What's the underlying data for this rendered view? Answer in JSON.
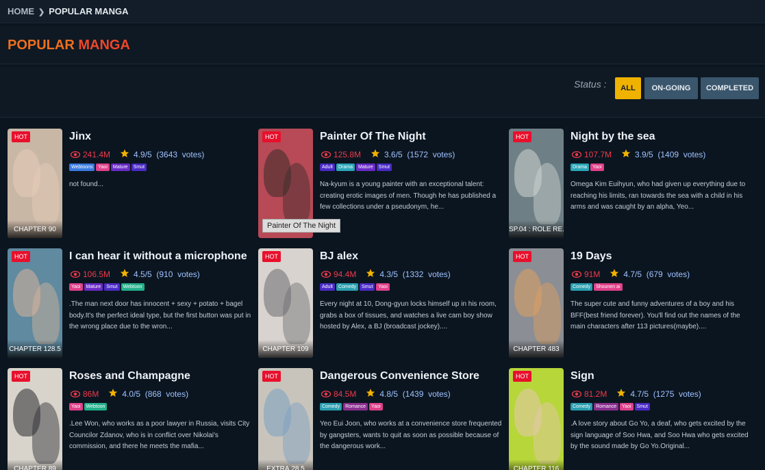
{
  "breadcrumb": {
    "home": "HOME",
    "current": "POPULAR MANGA"
  },
  "page_title": {
    "part1": "POPULAR ",
    "part2": "MANGA"
  },
  "filter": {
    "label": "Status :",
    "all": "ALL",
    "ongoing": "ON-GOING",
    "completed": "COMPLETED",
    "active": "ALL"
  },
  "tooltip": "Painter Of The Night",
  "tag_colors": {
    "Webtoons": "#3a7be0",
    "Yaoi": "#e0408a",
    "Mature": "#6a2bc7",
    "Smut": "#4a2bc7",
    "Adult": "#4a2bc7",
    "Drama": "#2aa7b8",
    "Comedy": "#2a9fb0",
    "Webtoon": "#23b08a",
    "Romance": "#8a2f8f",
    "Shounen ai": "#e0408a"
  },
  "cards": [
    {
      "title": "Jinx",
      "views": "241.4M",
      "rating": "4.9/5  (3643  votes)",
      "tags": [
        "Webtoons",
        "Yaoi",
        "Mature",
        "Smut"
      ],
      "desc": "not found...",
      "hot": "HOT",
      "chapter": "CHAPTER 90",
      "cover_color": "#c9b7a6",
      "fig_color": "#e6cdb8"
    },
    {
      "title": "Painter Of The Night",
      "views": "125.8M",
      "rating": "3.6/5  (1572  votes)",
      "tags": [
        "Adult",
        "Drama",
        "Mature",
        "Smut"
      ],
      "desc": "Na-kyum is a young painter with an exceptional talent: creating erotic images of men. Though he has published a few collections under a pseudonym, he...",
      "hot": "HOT",
      "chapter": "",
      "cover_color": "#b74a56",
      "fig_color": "#3a2c2a"
    },
    {
      "title": "Night by the sea",
      "views": "107.7M",
      "rating": "3.9/5  (1409  votes)",
      "tags": [
        "Drama",
        "Yaoi"
      ],
      "desc": "Omega Kim Euihyun, who had given up everything due to reaching his limits, ran towards the sea with a child in his arms and was caught by an alpha, Yeo...",
      "hot": "HOT",
      "chapter": "SP.04 : ROLE RE...",
      "cover_color": "#6f7f86",
      "fig_color": "#cfd6d2"
    },
    {
      "title": "I can hear it without a microphone",
      "views": "106.5M",
      "rating": "4.5/5  (910  votes)",
      "tags": [
        "Yaoi",
        "Mature",
        "Smut",
        "Webtoon"
      ],
      "desc": ".The man next door has innocent + sexy + potato + bagel body.It's the perfect ideal type, but the first button was put in the wrong place due to the wron...",
      "hot": "HOT",
      "chapter": "CHAPTER 128.5",
      "cover_color": "#5f8aa0",
      "fig_color": "#d9b39a"
    },
    {
      "title": "BJ alex",
      "views": "94.4M",
      "rating": "4.3/5  (1332  votes)",
      "tags": [
        "Adult",
        "Comedy",
        "Smut",
        "Yaoi"
      ],
      "desc": "Every night at 10, Dong-gyun locks himself up in his room, grabs a box of tissues, and watches a live cam boy show hosted by Alex, a BJ (broadcast jockey)....",
      "hot": "HOT",
      "chapter": "CHAPTER 109",
      "cover_color": "#d9d3cf",
      "fig_color": "#6c6c72"
    },
    {
      "title": "19 Days",
      "views": "91M",
      "rating": "4.7/5  (679  votes)",
      "tags": [
        "Comedy",
        "Shounen ai"
      ],
      "desc": "The super cute and funny adventures of a boy and his BFF(best friend forever). You'll find out the names of the main characters after 113 pictures(maybe)....",
      "hot": "HOT",
      "chapter": "CHAPTER 483",
      "cover_color": "#8b8e94",
      "fig_color": "#e0a060"
    },
    {
      "title": "Roses and Champagne",
      "views": "86M",
      "rating": "4.0/5  (868  votes)",
      "tags": [
        "Yaoi",
        "Webtoon"
      ],
      "desc": ".Lee Won, who works as a poor lawyer in Russia, visits City Councilor Zdanov, who is in conflict over Nikolai's commission, and there he meets the mafia...",
      "hot": "HOT",
      "chapter": "CHAPTER 89",
      "cover_color": "#d8d4cc",
      "fig_color": "#2a2a30"
    },
    {
      "title": "Dangerous Convenience Store",
      "views": "84.5M",
      "rating": "4.8/5  (1439  votes)",
      "tags": [
        "Comedy",
        "Romance",
        "Yaoi"
      ],
      "desc": "Yeo Eui Joon, who works at a convenience store frequented by gangsters, wants to quit as soon as possible because of the dangerous work...",
      "hot": "HOT",
      "chapter": "EXTRA.28.5",
      "cover_color": "#c8c4bc",
      "fig_color": "#7aa0c0"
    },
    {
      "title": "Sign",
      "views": "81.2M",
      "rating": "4.7/5  (1275  votes)",
      "tags": [
        "Comedy",
        "Romance",
        "Yaoi",
        "Smut"
      ],
      "desc": ".A love story about Go Yo, a deaf, who gets excited by the sign language of Soo Hwa, and Soo Hwa who gets excited by the sound made by Go Yo.Original...",
      "hot": "HOT",
      "chapter": "CHAPTER 116",
      "cover_color": "#b7d63a",
      "fig_color": "#e6c8b0"
    }
  ]
}
